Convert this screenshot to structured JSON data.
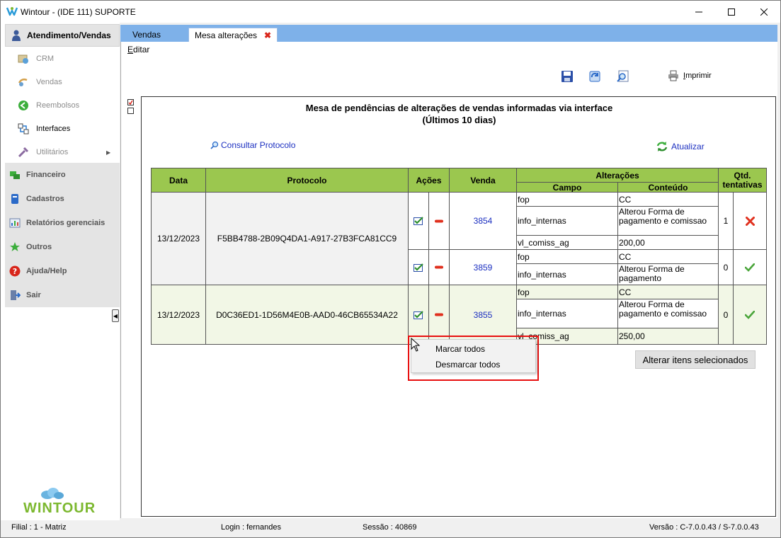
{
  "window": {
    "title": "Wintour - (IDE 111) SUPORTE"
  },
  "sidebar": {
    "header": "Atendimento/Vendas",
    "sub_items": [
      {
        "label": "CRM",
        "icon": "crm-icon"
      },
      {
        "label": "Vendas",
        "icon": "vendas-icon"
      },
      {
        "label": "Reembolsos",
        "icon": "reembolsos-icon"
      },
      {
        "label": "Interfaces",
        "icon": "interfaces-icon"
      },
      {
        "label": "Utilitários",
        "icon": "utilitarios-icon"
      }
    ],
    "sections": [
      {
        "label": "Financeiro"
      },
      {
        "label": "Cadastros"
      },
      {
        "label": "Relatórios gerenciais"
      },
      {
        "label": "Outros"
      },
      {
        "label": "Ajuda/Help"
      },
      {
        "label": "Sair"
      }
    ],
    "logo_text": "WINTOUR"
  },
  "tabs": [
    {
      "label": "Vendas"
    },
    {
      "label": "Mesa alterações"
    }
  ],
  "menu": {
    "edit_label_first": "E",
    "edit_label_rest": "ditar"
  },
  "toolbar": {
    "print_first": "I",
    "print_rest": "mprimir"
  },
  "panel": {
    "title_line1": "Mesa de pendências de alterações de vendas informadas via interface",
    "title_line2": "(Últimos 10 dias)",
    "consultar_label": "Consultar Protocolo",
    "atualizar_label": "Atualizar",
    "alterar_button": "Alterar itens selecionados"
  },
  "table": {
    "headers": {
      "data": "Data",
      "protocolo": "Protocolo",
      "acoes": "Ações",
      "venda": "Venda",
      "alteracoes": "Alterações",
      "campo": "Campo",
      "conteudo": "Conteúdo",
      "qtd": "Qtd. tentativas"
    },
    "groups": [
      {
        "data": "13/12/2023",
        "protocolo": "F5BB4788-2B09Q4DA1-A917-27B3FCA81CC9",
        "vendas": [
          {
            "venda": "3854",
            "tentativas": "1",
            "status": "error",
            "changes": [
              {
                "campo": "fop",
                "conteudo": "CC"
              },
              {
                "campo": "info_internas",
                "conteudo": "Alterou Forma de pagamento e comissao"
              },
              {
                "campo": "vl_comiss_ag",
                "conteudo": "200,00"
              }
            ]
          },
          {
            "venda": "3859",
            "tentativas": "0",
            "status": "ok",
            "changes": [
              {
                "campo": "fop",
                "conteudo": "CC"
              },
              {
                "campo": "info_internas",
                "conteudo": "Alterou Forma de pagamento"
              }
            ]
          }
        ]
      },
      {
        "data": "13/12/2023",
        "protocolo": "D0C36ED1-1D56M4E0B-AAD0-46CB65534A22",
        "vendas": [
          {
            "venda": "3855",
            "tentativas": "0",
            "status": "ok",
            "changes": [
              {
                "campo": "fop",
                "conteudo": "CC"
              },
              {
                "campo": "info_internas",
                "conteudo": "Alterou Forma de pagamento e comissao"
              },
              {
                "campo": "vl_comiss_ag",
                "conteudo": "250,00"
              }
            ]
          }
        ]
      }
    ]
  },
  "context_menu": {
    "items": [
      {
        "label": "Marcar todos"
      },
      {
        "label": "Desmarcar todos"
      }
    ]
  },
  "statusbar": {
    "filial": "Filial : 1 - Matriz",
    "login": "Login : fernandes",
    "sessao": "Sessão : 40869",
    "versao": "Versão : C-7.0.0.43 / S-7.0.0.43"
  },
  "colors": {
    "header_green": "#9bc74f",
    "tab_blue": "#7eb1e9",
    "link_blue": "#1b2fc0",
    "highlight_red": "#e81010",
    "row_alt": "#f2f7e6"
  }
}
